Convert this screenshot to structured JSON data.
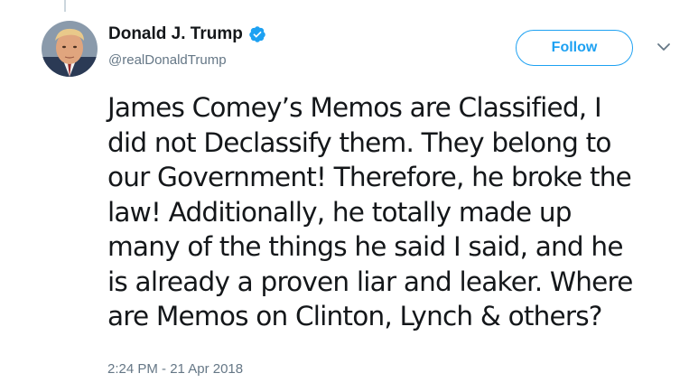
{
  "tweet": {
    "author": {
      "display_name": "Donald J. Trump",
      "handle": "@realDonaldTrump",
      "verified": true
    },
    "follow_label": "Follow",
    "text_lines": [
      "James Comey’s Memos are Classified, I",
      "did not Declassify them. They belong to",
      "our Government! Therefore, he broke the",
      "law! Additionally, he totally made up",
      "many of the things he said I said, and he",
      "is already a proven liar and leaker. Where",
      "are Memos on Clinton, Lynch & others?"
    ],
    "timestamp": "2:24 PM - 21 Apr 2018"
  },
  "colors": {
    "accent": "#1da1f2",
    "secondary_text": "#657786",
    "primary_text": "#14171a"
  },
  "icons": {
    "verified": "verified-badge-icon",
    "caret": "chevron-down-icon"
  }
}
